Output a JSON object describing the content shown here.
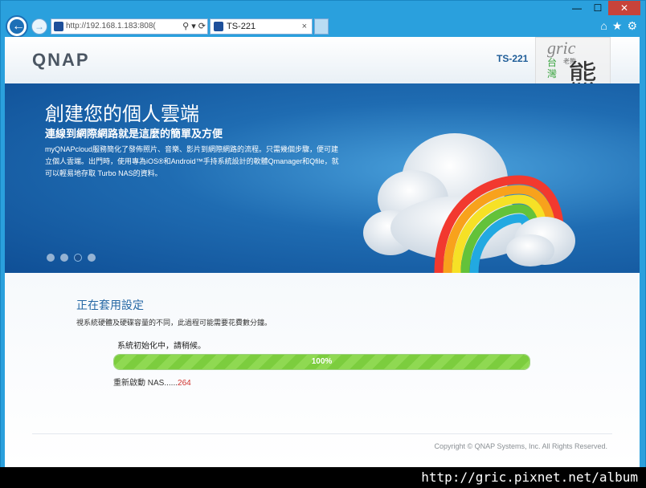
{
  "browser": {
    "address_text": "http://192.168.1.183:808(",
    "tab_label": "TS-221",
    "search_glyph": "⚲ ▾",
    "refresh_glyph": "⟳",
    "close_glyph": "✕",
    "min_glyph": "—",
    "max_glyph": "☐",
    "home_glyph": "⌂",
    "star_glyph": "★",
    "gear_glyph": "⚙"
  },
  "header": {
    "logo": "QNAP",
    "model": "TS-221"
  },
  "watermark": {
    "en": "gric",
    "tw": "台灣",
    "bear": "熊",
    "small": "老熊"
  },
  "banner": {
    "title": "創建您的個人雲端",
    "subtitle": "連線到網際網路就是這麼的簡單及方便",
    "desc": "myQNAPcloud服務簡化了發佈照片、音樂、影片到網際網路的流程。只需幾個步驟，便可建立個人雲端。出門時，使用專為iOS®和Android™手持系統設計的軟體Qmanager和Qfile，就可以輕易地存取 Turbo NAS的資料。",
    "active_slide": 3,
    "slides": 4
  },
  "content": {
    "title": "正在套用設定",
    "note": "視系統硬體及硬碟容量的不同，此過程可能需要花費數分鐘。",
    "progress_label": "系統初始化中，請稍候。",
    "progress_percent": "100%",
    "progress_value": 1.0,
    "status_prefix": "重新啟動 NAS......",
    "status_count": "264",
    "copyright": "Copyright © QNAP Systems, Inc. All Rights Reserved."
  },
  "footer_url": "http://gric.pixnet.net/album"
}
